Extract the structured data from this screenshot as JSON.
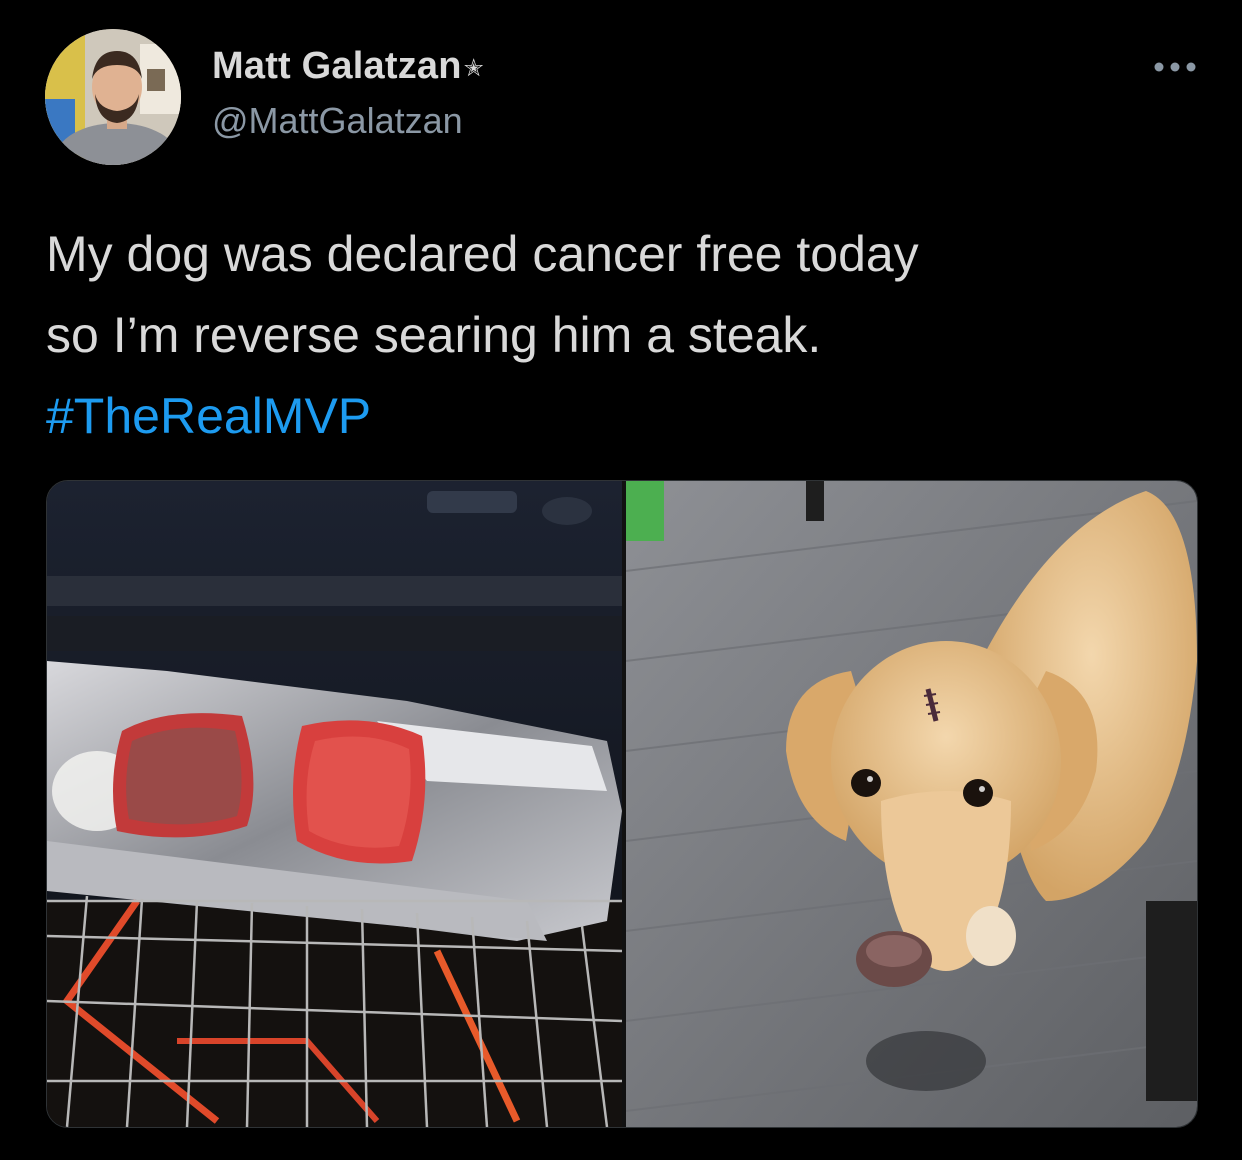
{
  "tweet": {
    "author": {
      "display_name": "Matt Galatzan",
      "verified_glyph": "✭",
      "handle": "@MattGalatzan"
    },
    "text_lines": [
      "My dog was declared cancer free today",
      "so I’m reverse searing him a steak."
    ],
    "hashtag": "#TheRealMVP",
    "more_menu_icon": "more-horizontal-icon",
    "media": [
      {
        "subject": "steaks-in-oven-photo"
      },
      {
        "subject": "golden-retriever-photo"
      }
    ]
  },
  "colors": {
    "background": "#000000",
    "text": "#d9d9d9",
    "secondary": "#8b98a5",
    "link": "#1d9bf0"
  }
}
